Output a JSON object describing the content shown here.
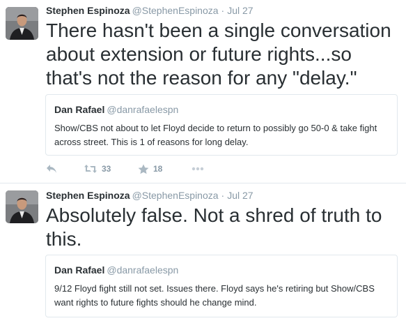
{
  "tweets": [
    {
      "author": "Stephen Espinoza",
      "handle": "@StephenEspinoza",
      "separator": "·",
      "time": "Jul 27",
      "text": "There hasn't been a single conversation about extension or future rights...so that's not the reason for any \"delay.\"",
      "quote": {
        "author": "Dan Rafael",
        "handle": "@danrafaelespn",
        "text": "Show/CBS not about to let Floyd decide to return to possibly go 50-0 & take fight across street. This is 1 of reasons for long delay."
      },
      "actions": {
        "icons": [
          "reply-icon",
          "retweet-icon",
          "favorite-icon",
          "more-icon"
        ],
        "retweets": "33",
        "favorites": "18"
      }
    },
    {
      "author": "Stephen Espinoza",
      "handle": "@StephenEspinoza",
      "separator": "·",
      "time": "Jul 27",
      "text": "Absolutely false. Not a shred of truth to this.",
      "quote": {
        "author": "Dan Rafael",
        "handle": "@danrafaelespn",
        "text": "9/12 Floyd fight still not set. Issues there. Floyd says he's retiring but Show/CBS want rights to future fights should he change mind."
      }
    }
  ],
  "colors": {
    "text": "#292f33",
    "muted": "#8899a6",
    "icon": "#aab8c2",
    "border": "#e1e8ed"
  }
}
